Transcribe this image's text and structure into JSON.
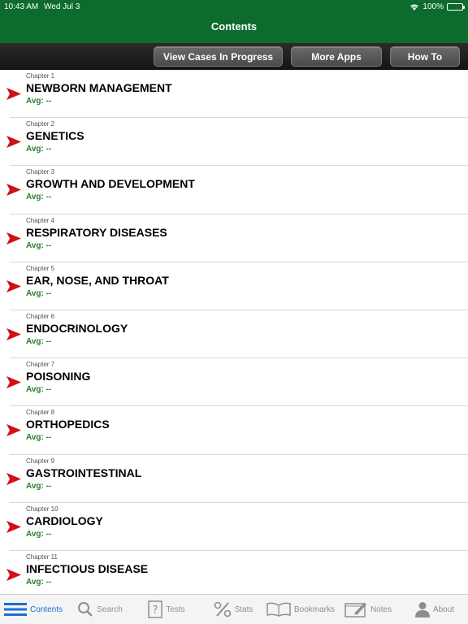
{
  "status": {
    "time": "10:43 AM",
    "date": "Wed Jul 3",
    "battery": "100%"
  },
  "header": {
    "title": "Contents"
  },
  "toolbar": {
    "view_cases": "View Cases In Progress",
    "more_apps": "More Apps",
    "how_to": "How To"
  },
  "chapters": [
    {
      "label": "Chapter 1",
      "title": "NEWBORN MANAGEMENT",
      "avg": "Avg: --"
    },
    {
      "label": "Chapter 2",
      "title": "GENETICS",
      "avg": "Avg: --"
    },
    {
      "label": "Chapter 3",
      "title": "GROWTH AND DEVELOPMENT",
      "avg": "Avg: --"
    },
    {
      "label": "Chapter 4",
      "title": "RESPIRATORY DISEASES",
      "avg": "Avg: --"
    },
    {
      "label": "Chapter 5",
      "title": "EAR, NOSE, AND THROAT",
      "avg": "Avg: --"
    },
    {
      "label": "Chapter 6",
      "title": "ENDOCRINOLOGY",
      "avg": "Avg: --"
    },
    {
      "label": "Chapter 7",
      "title": "POISONING",
      "avg": "Avg: --"
    },
    {
      "label": "Chapter 8",
      "title": "ORTHOPEDICS",
      "avg": "Avg: --"
    },
    {
      "label": "Chapter 9",
      "title": "GASTROINTESTINAL",
      "avg": "Avg: --"
    },
    {
      "label": "Chapter 10",
      "title": "CARDIOLOGY",
      "avg": "Avg: --"
    },
    {
      "label": "Chapter 11",
      "title": "INFECTIOUS DISEASE",
      "avg": "Avg: --"
    }
  ],
  "tabs": [
    {
      "label": "Contents",
      "icon": "list-icon",
      "active": true
    },
    {
      "label": "Search",
      "icon": "search-icon",
      "active": false
    },
    {
      "label": "Tests",
      "icon": "question-icon",
      "active": false
    },
    {
      "label": "Stats",
      "icon": "percent-icon",
      "active": false
    },
    {
      "label": "Bookmarks",
      "icon": "book-icon",
      "active": false
    },
    {
      "label": "Notes",
      "icon": "notes-icon",
      "active": false
    },
    {
      "label": "About",
      "icon": "person-icon",
      "active": false
    }
  ],
  "colors": {
    "header": "#0d6b2e",
    "avg": "#2d7a2d",
    "arrow": "#d0101a",
    "active_tab": "#1a6fd6"
  }
}
